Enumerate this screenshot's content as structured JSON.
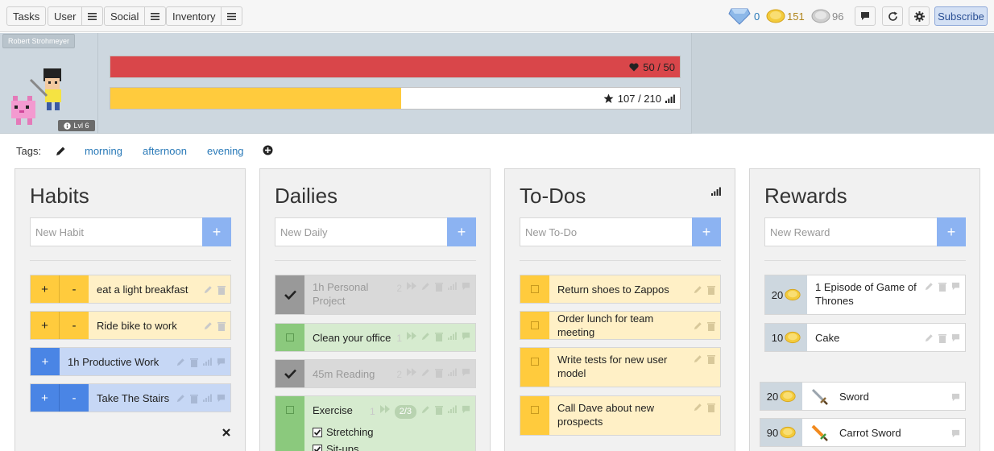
{
  "nav": {
    "tasks": "Tasks",
    "user": "User",
    "social": "Social",
    "inventory": "Inventory"
  },
  "currency": {
    "gems": "0",
    "gold": "151",
    "silver": "96"
  },
  "toolbar": {
    "subscribe": "Subscribe",
    "chat_icon": "chat-icon",
    "sync_icon": "sync-icon",
    "settings_icon": "gear-icon"
  },
  "user": {
    "name": "Robert Strohmeyer",
    "level": "Lvl 6",
    "health": {
      "text": "50 / 50",
      "fraction": 1.0,
      "color": "#d9464a"
    },
    "experience": {
      "text": "107 / 210",
      "fraction": 0.51,
      "color": "#ffcb3d"
    }
  },
  "tags": {
    "label": "Tags:",
    "items": [
      "morning",
      "afternoon",
      "evening"
    ]
  },
  "habits": {
    "title": "Habits",
    "placeholder": "New Habit",
    "items": [
      {
        "text": "eat a light breakfast"
      },
      {
        "text": "Ride bike to work"
      },
      {
        "text": "1h Productive Work"
      },
      {
        "text": "Take The Stairs"
      }
    ]
  },
  "dailies": {
    "title": "Dailies",
    "placeholder": "New Daily",
    "items": [
      {
        "text": "1h Personal Project",
        "streak": "2"
      },
      {
        "text": "Clean your office",
        "streak": "1"
      },
      {
        "text": "45m Reading",
        "streak": "2"
      },
      {
        "text": "Exercise",
        "streak": "1",
        "progress": "2/3",
        "checklist": [
          "Stretching",
          "Sit-ups"
        ]
      }
    ]
  },
  "todos": {
    "title": "To-Dos",
    "placeholder": "New To-Do",
    "items": [
      {
        "text": "Return shoes to Zappos"
      },
      {
        "text": "Order lunch for team meeting"
      },
      {
        "text": "Write tests for new user model"
      },
      {
        "text": "Call Dave about new prospects"
      }
    ]
  },
  "rewards": {
    "title": "Rewards",
    "placeholder": "New Reward",
    "items": [
      {
        "cost": "20",
        "text": "1 Episode of Game of Thrones"
      },
      {
        "cost": "10",
        "text": "Cake"
      }
    ],
    "shop": [
      {
        "cost": "20",
        "text": "Sword"
      },
      {
        "cost": "90",
        "text": "Carrot Sword"
      }
    ]
  },
  "colors": {
    "habit_yellow": "#ffcb3d",
    "habit_yellow_light": "#fff0c6",
    "habit_blue": "#4a85e5",
    "habit_blue_light": "#c6d7f5",
    "daily_grey": "#999999",
    "daily_grey_light": "#d9d9d9",
    "daily_green": "#8bc97d",
    "daily_green_light": "#d6ebcf",
    "accent": "#2a7ab8"
  }
}
